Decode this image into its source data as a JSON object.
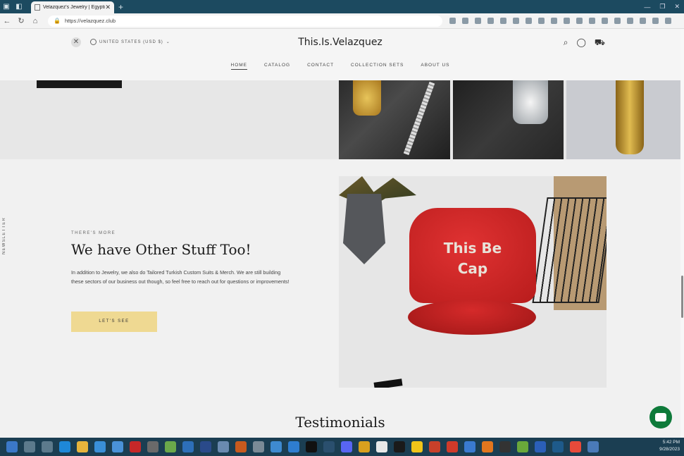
{
  "browser": {
    "tab_title": "Velazquez's Jewelry | Egyptian Silv",
    "url": "https://velazquez.club"
  },
  "header": {
    "locale": "UNITED STATES (USD $)",
    "brand": "This.Is.Velazquez",
    "nav": [
      "HOME",
      "CATALOG",
      "CONTACT",
      "COLLECTION SETS",
      "ABOUT US"
    ]
  },
  "promo": {
    "eyebrow": "THERE'S MORE",
    "title": "We have Other Stuff Too!",
    "body": "In addition to Jewelry, we also do Tailored Turkish Custom Suits & Merch. We are still building these sectors of our business out though, so feel free to reach out for questions or improvements!",
    "button": "LET'S SEE",
    "image_text_line1": "This Be",
    "image_text_line2": "Cap"
  },
  "section_title": "Testimonials",
  "newsletter": "NEWSLETTER",
  "taskbar": {
    "time": "5:42 PM",
    "date": "9/28/2023"
  },
  "colors": {
    "tabbar": "#1c4a60",
    "button_yellow": "#efd992",
    "cap_red": "#c62222",
    "chat_green": "#0e7a3a"
  }
}
